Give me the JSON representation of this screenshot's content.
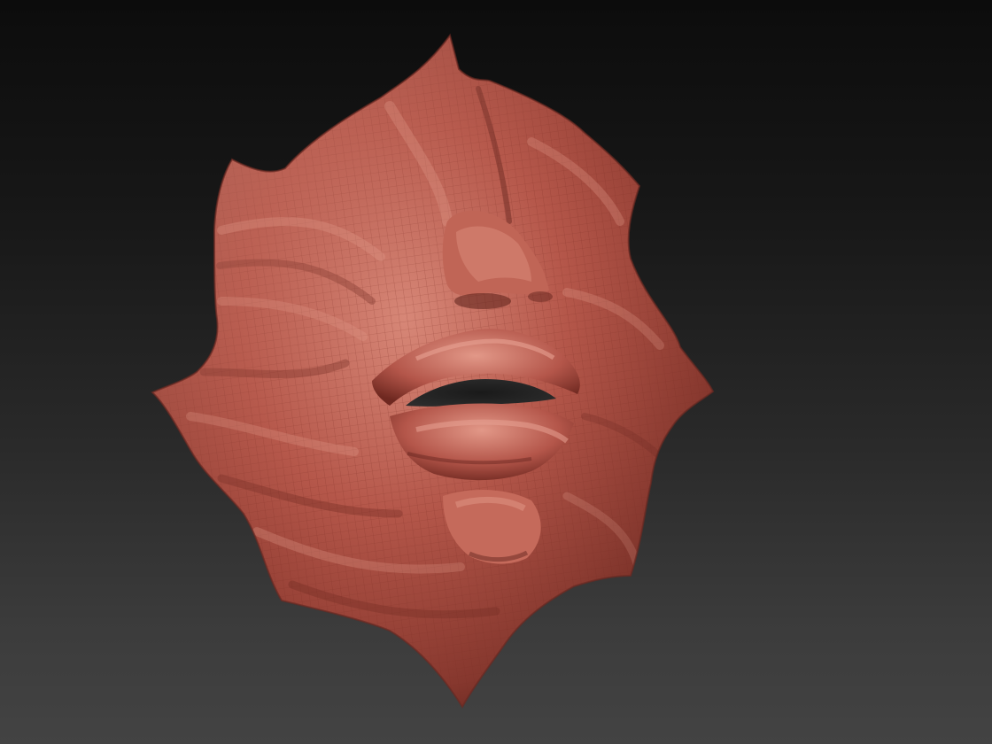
{
  "viewport": {
    "background_top": "#0c0c0c",
    "background_bottom": "#434343"
  },
  "model": {
    "subject": "sculpted-mouth-and-nose-mesh",
    "material_color": "#b5574a",
    "highlight_color": "#d98a7a",
    "shadow_color": "#5a1f18",
    "wireframe_color": "#7a2e24"
  }
}
